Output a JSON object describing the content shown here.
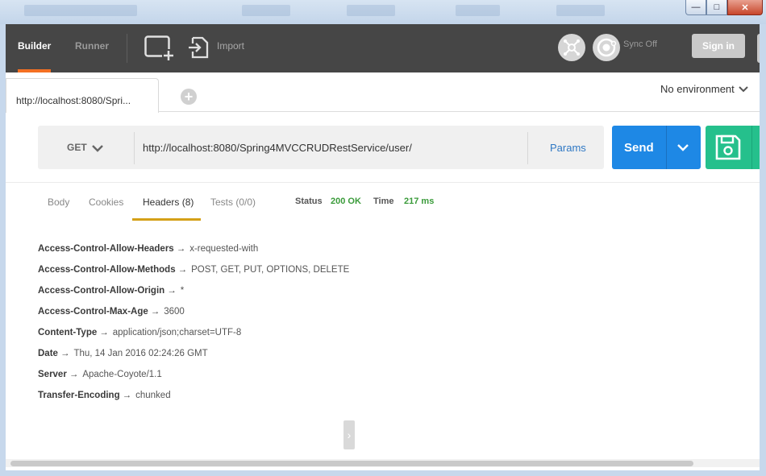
{
  "header": {
    "tabs": [
      "Builder",
      "Runner"
    ],
    "import_label": "Import",
    "sync_label": "Sync Off",
    "signin_label": "Sign in"
  },
  "request_tab": {
    "label": "http://localhost:8080/Spri..."
  },
  "environment": {
    "selected": "No environment"
  },
  "request": {
    "method": "GET",
    "url": "http://localhost:8080/Spring4MVCCRUDRestService/user/",
    "params_label": "Params",
    "send_label": "Send"
  },
  "response": {
    "tabs": [
      "Body",
      "Cookies",
      "Headers (8)",
      "Tests (0/0)"
    ],
    "active_tab": "Headers (8)",
    "status_key": "Status",
    "status_value": "200 OK",
    "time_key": "Time",
    "time_value": "217 ms",
    "headers": [
      {
        "key": "Access-Control-Allow-Headers",
        "value": "x-requested-with"
      },
      {
        "key": "Access-Control-Allow-Methods",
        "value": "POST, GET, PUT, OPTIONS, DELETE"
      },
      {
        "key": "Access-Control-Allow-Origin",
        "value": "*"
      },
      {
        "key": "Access-Control-Max-Age",
        "value": "3600"
      },
      {
        "key": "Content-Type",
        "value": "application/json;charset=UTF-8"
      },
      {
        "key": "Date",
        "value": "Thu, 14 Jan 2016 02:24:26 GMT"
      },
      {
        "key": "Server",
        "value": "Apache-Coyote/1.1"
      },
      {
        "key": "Transfer-Encoding",
        "value": "chunked"
      }
    ],
    "arrow": "→"
  },
  "colors": {
    "header_bg": "#464646",
    "accent_orange": "#f47023",
    "send_blue": "#1e88e5",
    "save_green": "#25c08c",
    "status_green": "#3a9b3a",
    "tab_underline": "#d4a017"
  },
  "icons": [
    "new-window-icon",
    "import-icon",
    "interceptor-icon",
    "sync-icon",
    "chevron-down-icon",
    "plus-icon",
    "save-icon",
    "chevron-right-icon"
  ]
}
